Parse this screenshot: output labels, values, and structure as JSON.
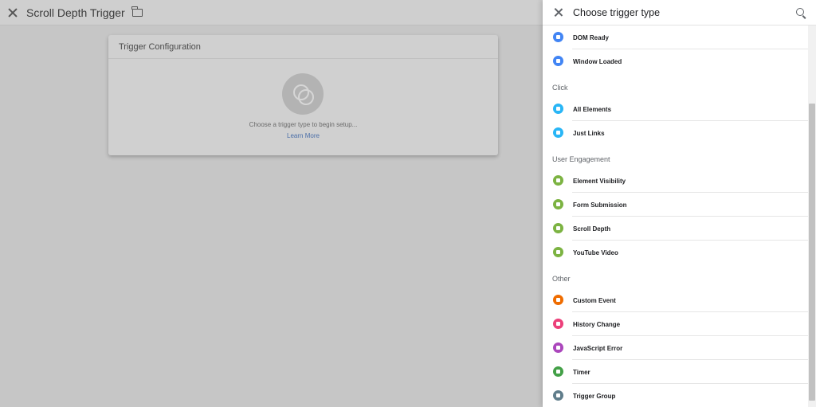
{
  "editor": {
    "title": "Scroll Depth Trigger",
    "card_title": "Trigger Configuration",
    "hint": "Choose a trigger type to begin setup...",
    "learn_more": "Learn More"
  },
  "panel": {
    "title": "Choose trigger type",
    "sections": [
      {
        "title": "",
        "items": [
          {
            "label": "DOM Ready",
            "icon": "document-icon",
            "color": "#4285f4"
          },
          {
            "label": "Window Loaded",
            "icon": "window-icon",
            "color": "#4285f4"
          }
        ]
      },
      {
        "title": "Click",
        "items": [
          {
            "label": "All Elements",
            "icon": "cursor-icon",
            "color": "#29b6f6"
          },
          {
            "label": "Just Links",
            "icon": "link-icon",
            "color": "#29b6f6"
          }
        ]
      },
      {
        "title": "User Engagement",
        "items": [
          {
            "label": "Element Visibility",
            "icon": "eye-icon",
            "color": "#7cb342"
          },
          {
            "label": "Form Submission",
            "icon": "form-icon",
            "color": "#7cb342"
          },
          {
            "label": "Scroll Depth",
            "icon": "scroll-icon",
            "color": "#7cb342"
          },
          {
            "label": "YouTube Video",
            "icon": "play-icon",
            "color": "#7cb342"
          }
        ]
      },
      {
        "title": "Other",
        "items": [
          {
            "label": "Custom Event",
            "icon": "code-icon",
            "color": "#ef6c00"
          },
          {
            "label": "History Change",
            "icon": "history-icon",
            "color": "#ec407a"
          },
          {
            "label": "JavaScript Error",
            "icon": "warning-icon",
            "color": "#ab47bc"
          },
          {
            "label": "Timer",
            "icon": "timer-icon",
            "color": "#43a047"
          },
          {
            "label": "Trigger Group",
            "icon": "group-icon",
            "color": "#607d8b"
          }
        ]
      }
    ]
  }
}
